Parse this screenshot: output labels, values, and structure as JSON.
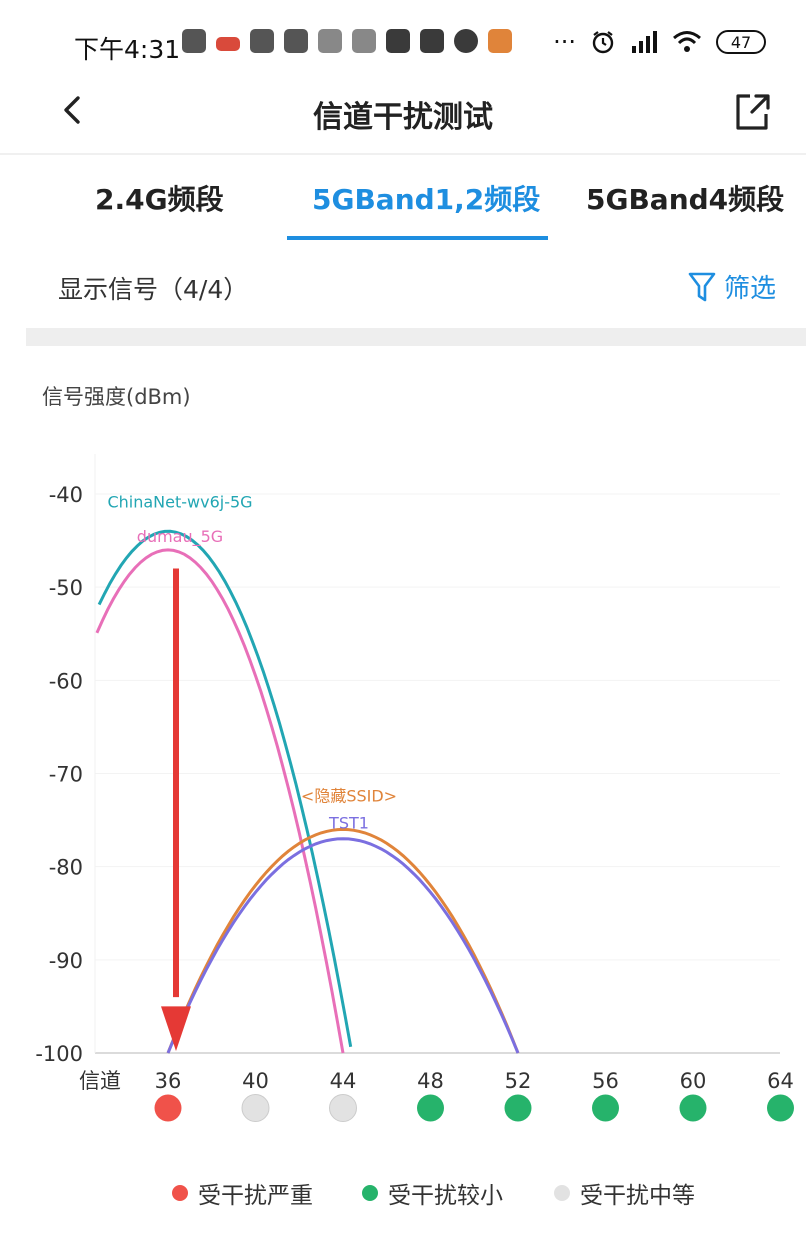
{
  "status_bar": {
    "time": "下午4:31",
    "more": "···",
    "battery": "47",
    "icons": [
      "app-icon",
      "app-icon",
      "app-icon",
      "app-icon",
      "app-icon",
      "app-icon",
      "app-icon",
      "app-icon",
      "check-icon",
      "app-icon",
      "alarm-icon",
      "signal-icon",
      "wifi-icon",
      "battery-icon"
    ]
  },
  "nav": {
    "title": "信道干扰测试",
    "back_icon": "chevron-left-icon",
    "share_icon": "share-icon"
  },
  "tabs": [
    {
      "label": "2.4G频段",
      "active": false
    },
    {
      "label": "5GBand1,2频段",
      "active": true
    },
    {
      "label": "5GBand4频段",
      "active": false
    }
  ],
  "filter_row": {
    "signal_count": "显示信号（4/4）",
    "filter_label": "筛选",
    "filter_icon": "funnel-icon"
  },
  "chart_data": {
    "type": "line",
    "ylabel": "信号强度(dBm)",
    "xlabel": "信道",
    "ylim": [
      -100,
      -40
    ],
    "yticks": [
      "-40",
      "-50",
      "-60",
      "-70",
      "-80",
      "-90",
      "-100"
    ],
    "x_categories": [
      "36",
      "40",
      "44",
      "48",
      "52",
      "56",
      "60",
      "64"
    ],
    "series": [
      {
        "name": "ChinaNet-wv6j-5G",
        "color": "#22a6b3",
        "peak_channel": 36,
        "peak_dbm": -44
      },
      {
        "name": "dumau_5G",
        "color": "#e86fb8",
        "peak_channel": 36,
        "peak_dbm": -46
      },
      {
        "name": "<隐藏SSID>",
        "color": "#e0843a",
        "peak_channel": 44,
        "peak_dbm": -76
      },
      {
        "name": "TST1",
        "color": "#7b6fe0",
        "peak_channel": 44,
        "peak_dbm": -77
      }
    ],
    "channel_status": [
      {
        "channel": "36",
        "status": "severe"
      },
      {
        "channel": "40",
        "status": "medium"
      },
      {
        "channel": "44",
        "status": "medium"
      },
      {
        "channel": "48",
        "status": "low"
      },
      {
        "channel": "52",
        "status": "low"
      },
      {
        "channel": "56",
        "status": "low"
      },
      {
        "channel": "60",
        "status": "low"
      },
      {
        "channel": "64",
        "status": "low"
      }
    ]
  },
  "legend": [
    {
      "label": "受干扰严重",
      "color": "#f0524a"
    },
    {
      "label": "受干扰较小",
      "color": "#26b36b"
    },
    {
      "label": "受干扰中等",
      "color": "#e2e2e2"
    }
  ],
  "colors": {
    "accent": "#1e8ee0",
    "severe": "#f0524a",
    "low": "#26b36b",
    "medium": "#e2e2e2",
    "arrow": "#e53935"
  }
}
